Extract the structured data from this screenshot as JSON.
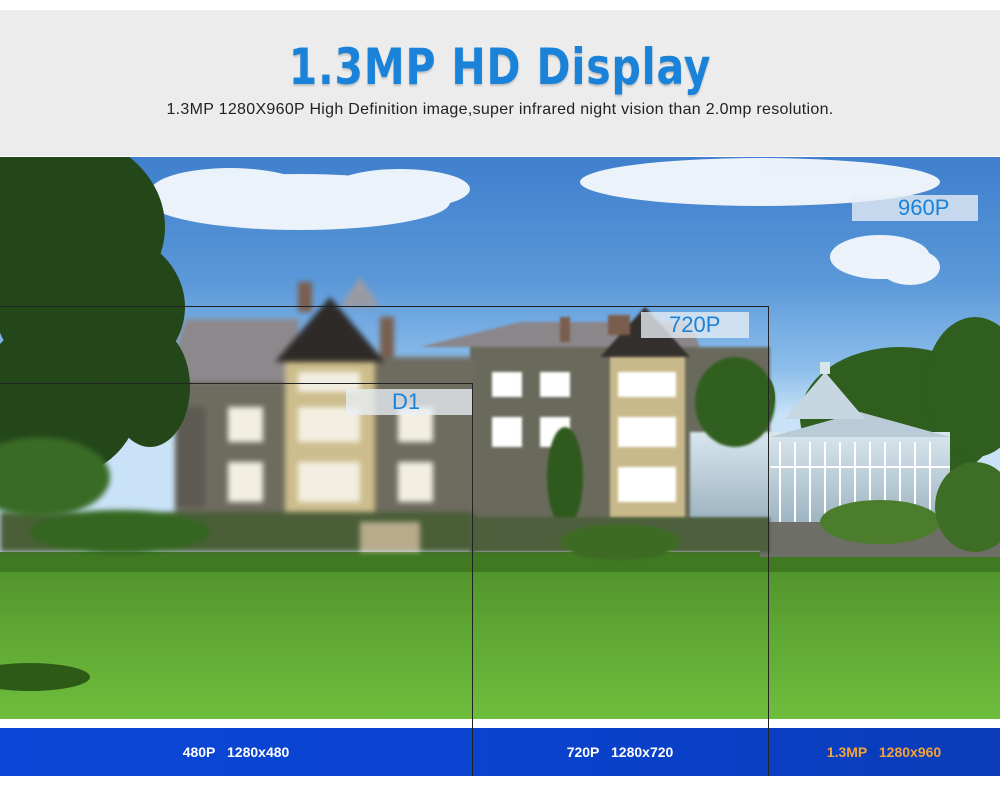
{
  "header": {
    "title": "1.3MP HD Display",
    "subtitle": "1.3MP 1280X960P High Definition image,super infrared night vision than 2.0mp resolution."
  },
  "overlays": {
    "label_960": "960P",
    "label_720": "720P",
    "label_d1": "D1"
  },
  "resolution_bar": {
    "seg_480": "480P   1280x480",
    "seg_720": "720P   1280x720",
    "seg_13mp": "1.3MP   1280x960"
  },
  "colors": {
    "title": "#1a82d8",
    "bar": "#0a43cf",
    "highlight": "#f4a33a"
  }
}
